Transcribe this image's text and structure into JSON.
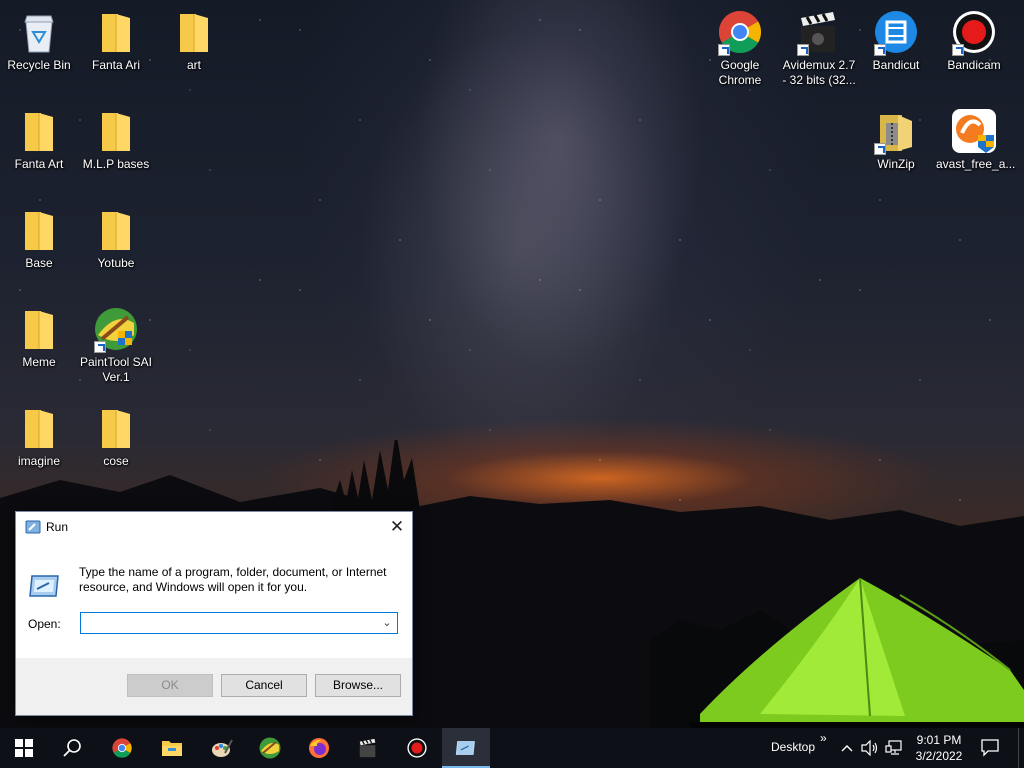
{
  "desktop_icons": [
    {
      "label": "Recycle Bin",
      "type": "recycle"
    },
    {
      "label": "Fanta Ari",
      "type": "folder"
    },
    {
      "label": "art",
      "type": "folder"
    },
    {
      "label": "Fanta Art",
      "type": "folder"
    },
    {
      "label": "M.L.P bases",
      "type": "folder"
    },
    {
      "label": "Base",
      "type": "folder"
    },
    {
      "label": "Yotube",
      "type": "folder"
    },
    {
      "label": "Meme",
      "type": "folder"
    },
    {
      "label": "PaintTool SAI Ver.1",
      "type": "app"
    },
    {
      "label": "imagine",
      "type": "folder"
    },
    {
      "label": "cose",
      "type": "folder"
    },
    {
      "label": "Google Chrome",
      "type": "chrome"
    },
    {
      "label": "Avidemux 2.7 - 32 bits (32...",
      "type": "avidemux"
    },
    {
      "label": "Bandicut",
      "type": "bandicut"
    },
    {
      "label": "Bandicam",
      "type": "bandicam"
    },
    {
      "label": "WinZip",
      "type": "winzip"
    },
    {
      "label": "avast_free_a...",
      "type": "avast"
    }
  ],
  "run_dialog": {
    "title": "Run",
    "close_glyph": "✕",
    "description": "Type the name of a program, folder, document, or Internet resource, and Windows will open it for you.",
    "open_label": "Open:",
    "open_value": "",
    "ok_label": "OK",
    "cancel_label": "Cancel",
    "browse_label": "Browse..."
  },
  "taskbar": {
    "start_icon": "windows-logo",
    "pinned": [
      "search-icon",
      "chrome-icon",
      "file-explorer-icon",
      "paint-palette-icon",
      "painttool-sai-icon",
      "firefox-icon",
      "avidemux-icon",
      "bandicam-icon",
      "run-icon"
    ],
    "desktop_toolbar_label": "Desktop",
    "overflow_chevron": "»",
    "time": "9:01 PM",
    "date": "3/2/2022"
  },
  "colors": {
    "taskbar_bg": "#0d1117",
    "accent": "#0078d7",
    "folder": "#f7c948"
  }
}
